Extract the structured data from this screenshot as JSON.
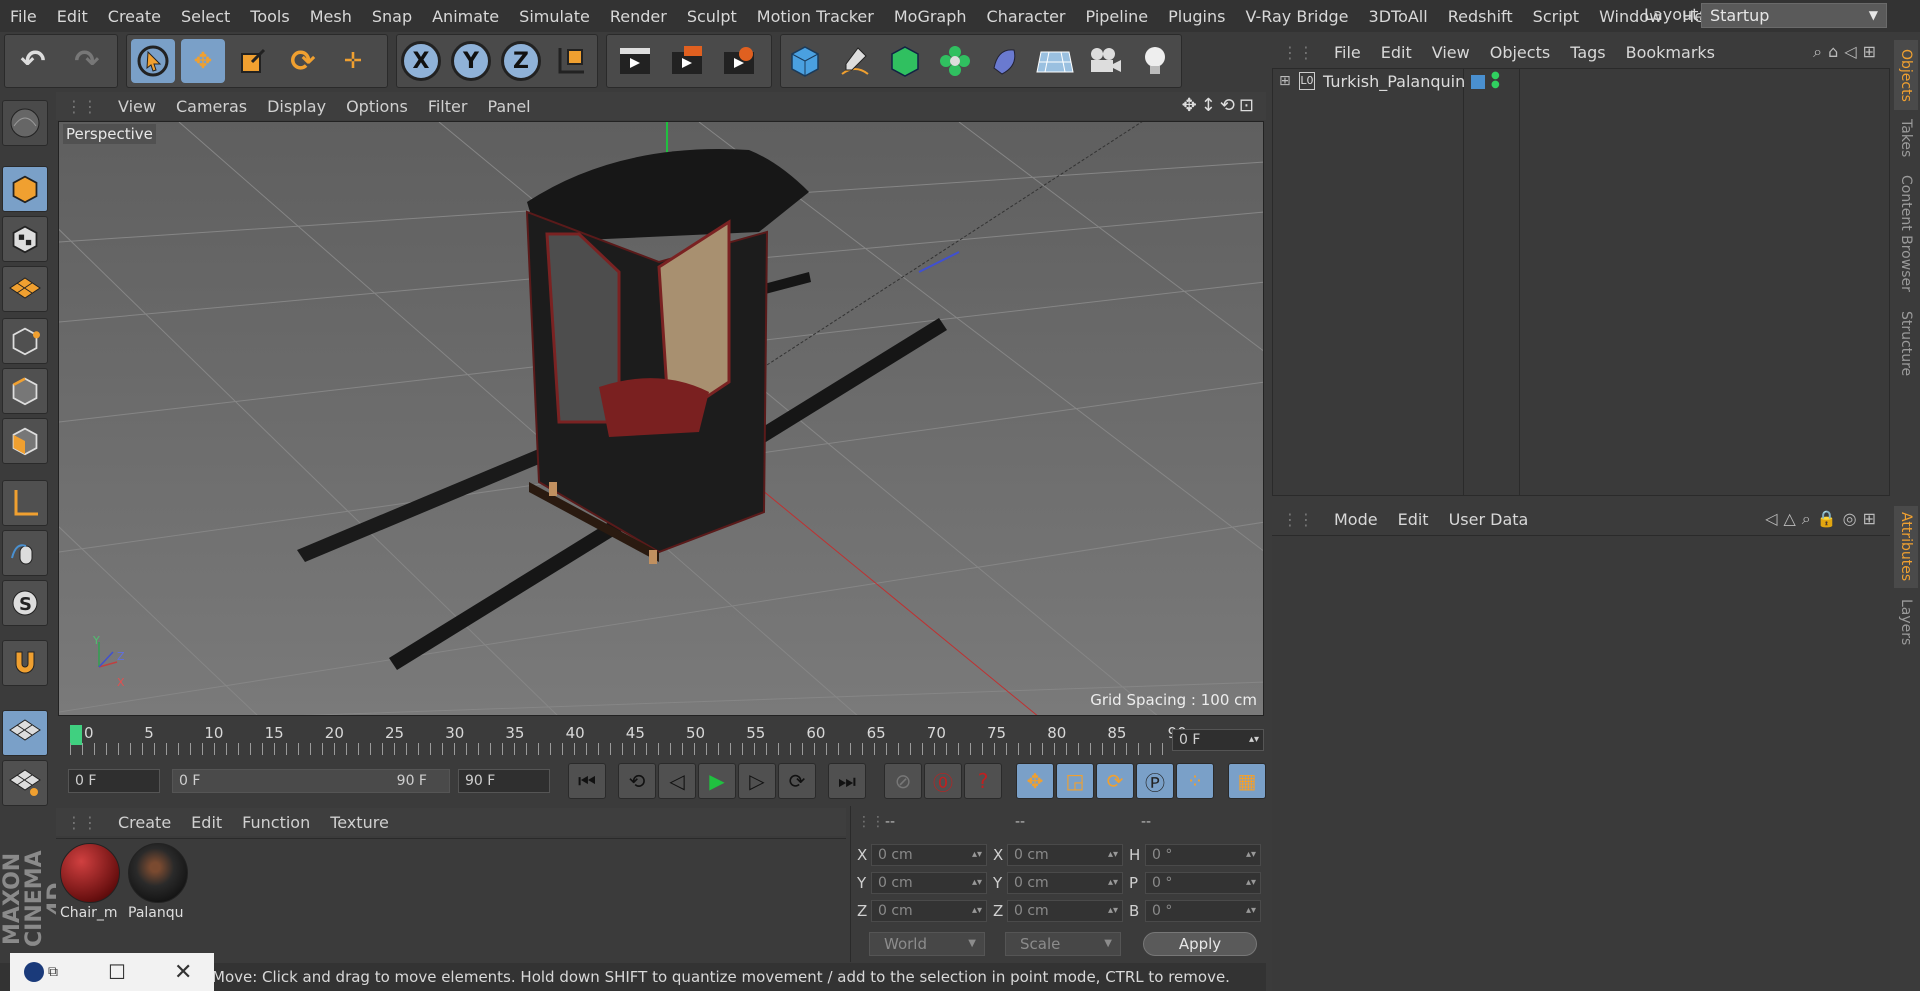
{
  "menubar": {
    "items": [
      "File",
      "Edit",
      "Create",
      "Select",
      "Tools",
      "Mesh",
      "Snap",
      "Animate",
      "Simulate",
      "Render",
      "Sculpt",
      "Motion Tracker",
      "MoGraph",
      "Character",
      "Pipeline",
      "Plugins",
      "V-Ray Bridge",
      "3DToAll",
      "Redshift",
      "Script",
      "Window",
      "Help"
    ],
    "layout_label": "Layout:",
    "layout_value": "Startup"
  },
  "toolbar": {
    "axis_x": "X",
    "axis_y": "Y",
    "axis_z": "Z"
  },
  "viewport": {
    "menu": [
      "View",
      "Cameras",
      "Display",
      "Options",
      "Filter",
      "Panel"
    ],
    "label": "Perspective",
    "grid_spacing": "Grid Spacing : 100 cm",
    "axis_y": "Y",
    "axis_z": "Z",
    "axis_x": "X"
  },
  "timeline": {
    "ticks": [
      "0",
      "5",
      "10",
      "15",
      "20",
      "25",
      "30",
      "35",
      "40",
      "45",
      "50",
      "55",
      "60",
      "65",
      "70",
      "75",
      "80",
      "85",
      "90"
    ],
    "current_frame": "0 F",
    "start_field": "0 F",
    "range_start": "0 F",
    "range_end": "90 F",
    "end_field": "90 F"
  },
  "materials": {
    "menu": [
      "Create",
      "Edit",
      "Function",
      "Texture"
    ],
    "items": [
      {
        "name": "Chair_m",
        "color": "#8a1e1e"
      },
      {
        "name": "Palanqu",
        "color": "#1a1a1a"
      }
    ]
  },
  "coordinates": {
    "headers": [
      "--",
      "--",
      "--"
    ],
    "rows": [
      {
        "l1": "X",
        "v1": "0 cm",
        "l2": "X",
        "v2": "0 cm",
        "l3": "H",
        "v3": "0 °"
      },
      {
        "l1": "Y",
        "v1": "0 cm",
        "l2": "Y",
        "v2": "0 cm",
        "l3": "P",
        "v3": "0 °"
      },
      {
        "l1": "Z",
        "v1": "0 cm",
        "l2": "Z",
        "v2": "0 cm",
        "l3": "B",
        "v3": "0 °"
      }
    ],
    "world": "World",
    "scale": "Scale",
    "apply": "Apply"
  },
  "status": {
    "text": "Move: Click and drag to move elements. Hold down SHIFT to quantize movement / add to the selection in point mode, CTRL to remove."
  },
  "objects": {
    "menu": [
      "File",
      "Edit",
      "View",
      "Objects",
      "Tags",
      "Bookmarks"
    ],
    "rows": [
      {
        "name": "Turkish_Palanquin",
        "layer": "L0"
      }
    ]
  },
  "attributes": {
    "menu": [
      "Mode",
      "Edit",
      "User Data"
    ]
  },
  "side_tabs": [
    "Objects",
    "Takes",
    "Content Browser",
    "Structure",
    "Attributes",
    "Layers"
  ],
  "logo": {
    "line1": "MAXON",
    "line2": "CINEMA 4D"
  },
  "colors": {
    "accent": "#f0a030",
    "selected": "#7aa0c8",
    "panel": "#3b3b3b"
  }
}
